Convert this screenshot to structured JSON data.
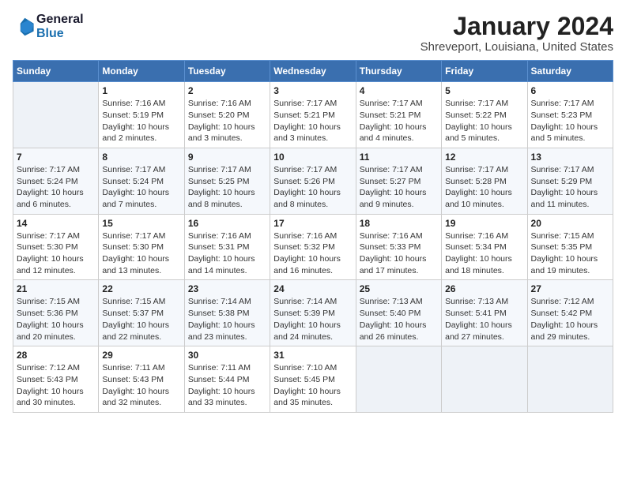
{
  "header": {
    "logo_line1": "General",
    "logo_line2": "Blue",
    "month_year": "January 2024",
    "location": "Shreveport, Louisiana, United States"
  },
  "days_of_week": [
    "Sunday",
    "Monday",
    "Tuesday",
    "Wednesday",
    "Thursday",
    "Friday",
    "Saturday"
  ],
  "weeks": [
    [
      {
        "day": "",
        "info": ""
      },
      {
        "day": "1",
        "info": "Sunrise: 7:16 AM\nSunset: 5:19 PM\nDaylight: 10 hours\nand 2 minutes."
      },
      {
        "day": "2",
        "info": "Sunrise: 7:16 AM\nSunset: 5:20 PM\nDaylight: 10 hours\nand 3 minutes."
      },
      {
        "day": "3",
        "info": "Sunrise: 7:17 AM\nSunset: 5:21 PM\nDaylight: 10 hours\nand 3 minutes."
      },
      {
        "day": "4",
        "info": "Sunrise: 7:17 AM\nSunset: 5:21 PM\nDaylight: 10 hours\nand 4 minutes."
      },
      {
        "day": "5",
        "info": "Sunrise: 7:17 AM\nSunset: 5:22 PM\nDaylight: 10 hours\nand 5 minutes."
      },
      {
        "day": "6",
        "info": "Sunrise: 7:17 AM\nSunset: 5:23 PM\nDaylight: 10 hours\nand 5 minutes."
      }
    ],
    [
      {
        "day": "7",
        "info": "Sunrise: 7:17 AM\nSunset: 5:24 PM\nDaylight: 10 hours\nand 6 minutes."
      },
      {
        "day": "8",
        "info": "Sunrise: 7:17 AM\nSunset: 5:24 PM\nDaylight: 10 hours\nand 7 minutes."
      },
      {
        "day": "9",
        "info": "Sunrise: 7:17 AM\nSunset: 5:25 PM\nDaylight: 10 hours\nand 8 minutes."
      },
      {
        "day": "10",
        "info": "Sunrise: 7:17 AM\nSunset: 5:26 PM\nDaylight: 10 hours\nand 8 minutes."
      },
      {
        "day": "11",
        "info": "Sunrise: 7:17 AM\nSunset: 5:27 PM\nDaylight: 10 hours\nand 9 minutes."
      },
      {
        "day": "12",
        "info": "Sunrise: 7:17 AM\nSunset: 5:28 PM\nDaylight: 10 hours\nand 10 minutes."
      },
      {
        "day": "13",
        "info": "Sunrise: 7:17 AM\nSunset: 5:29 PM\nDaylight: 10 hours\nand 11 minutes."
      }
    ],
    [
      {
        "day": "14",
        "info": "Sunrise: 7:17 AM\nSunset: 5:30 PM\nDaylight: 10 hours\nand 12 minutes."
      },
      {
        "day": "15",
        "info": "Sunrise: 7:17 AM\nSunset: 5:30 PM\nDaylight: 10 hours\nand 13 minutes."
      },
      {
        "day": "16",
        "info": "Sunrise: 7:16 AM\nSunset: 5:31 PM\nDaylight: 10 hours\nand 14 minutes."
      },
      {
        "day": "17",
        "info": "Sunrise: 7:16 AM\nSunset: 5:32 PM\nDaylight: 10 hours\nand 16 minutes."
      },
      {
        "day": "18",
        "info": "Sunrise: 7:16 AM\nSunset: 5:33 PM\nDaylight: 10 hours\nand 17 minutes."
      },
      {
        "day": "19",
        "info": "Sunrise: 7:16 AM\nSunset: 5:34 PM\nDaylight: 10 hours\nand 18 minutes."
      },
      {
        "day": "20",
        "info": "Sunrise: 7:15 AM\nSunset: 5:35 PM\nDaylight: 10 hours\nand 19 minutes."
      }
    ],
    [
      {
        "day": "21",
        "info": "Sunrise: 7:15 AM\nSunset: 5:36 PM\nDaylight: 10 hours\nand 20 minutes."
      },
      {
        "day": "22",
        "info": "Sunrise: 7:15 AM\nSunset: 5:37 PM\nDaylight: 10 hours\nand 22 minutes."
      },
      {
        "day": "23",
        "info": "Sunrise: 7:14 AM\nSunset: 5:38 PM\nDaylight: 10 hours\nand 23 minutes."
      },
      {
        "day": "24",
        "info": "Sunrise: 7:14 AM\nSunset: 5:39 PM\nDaylight: 10 hours\nand 24 minutes."
      },
      {
        "day": "25",
        "info": "Sunrise: 7:13 AM\nSunset: 5:40 PM\nDaylight: 10 hours\nand 26 minutes."
      },
      {
        "day": "26",
        "info": "Sunrise: 7:13 AM\nSunset: 5:41 PM\nDaylight: 10 hours\nand 27 minutes."
      },
      {
        "day": "27",
        "info": "Sunrise: 7:12 AM\nSunset: 5:42 PM\nDaylight: 10 hours\nand 29 minutes."
      }
    ],
    [
      {
        "day": "28",
        "info": "Sunrise: 7:12 AM\nSunset: 5:43 PM\nDaylight: 10 hours\nand 30 minutes."
      },
      {
        "day": "29",
        "info": "Sunrise: 7:11 AM\nSunset: 5:43 PM\nDaylight: 10 hours\nand 32 minutes."
      },
      {
        "day": "30",
        "info": "Sunrise: 7:11 AM\nSunset: 5:44 PM\nDaylight: 10 hours\nand 33 minutes."
      },
      {
        "day": "31",
        "info": "Sunrise: 7:10 AM\nSunset: 5:45 PM\nDaylight: 10 hours\nand 35 minutes."
      },
      {
        "day": "",
        "info": ""
      },
      {
        "day": "",
        "info": ""
      },
      {
        "day": "",
        "info": ""
      }
    ]
  ]
}
